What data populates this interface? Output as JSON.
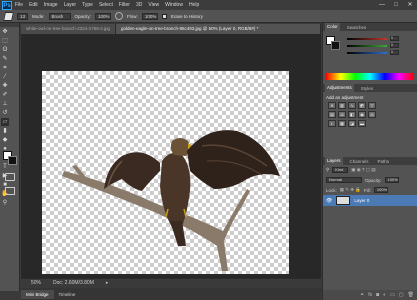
{
  "app": {
    "logo": "Ps"
  },
  "menu": [
    "File",
    "Edit",
    "Image",
    "Layer",
    "Type",
    "Select",
    "Filter",
    "3D",
    "View",
    "Window",
    "Help"
  ],
  "window_controls": {
    "minimize": "—",
    "maximize": "□",
    "close": "✕"
  },
  "options_bar": {
    "mode_label": "Mode:",
    "mode_value": "Brush",
    "opacity_label": "Opacity:",
    "opacity_value": "100%",
    "flow_label": "Flow:",
    "flow_value": "100%",
    "erase_history_label": "Erase to History",
    "brush_size": "13"
  },
  "doc_tabs": [
    {
      "label": "white-owl-on-tree-branch-2324-2758-2.jpg"
    },
    {
      "label": "golden-eagle-on-tree-branch-86c493.jpg @ 50% (Layer 0, RGB/8#) *"
    }
  ],
  "status": {
    "zoom": "50%",
    "doc": "Doc: 2.60M/3.80M"
  },
  "bottom_tabs": [
    "Mini Bridge",
    "Timeline"
  ],
  "color_panel": {
    "tabs": [
      "Color",
      "Swatches"
    ],
    "sliders": [
      {
        "value": "0"
      },
      {
        "value": "0"
      },
      {
        "value": "0"
      }
    ],
    "colors": {
      "r": "#c0392b",
      "g": "#3aaa35",
      "b": "#2d6fd6"
    }
  },
  "adjustments_panel": {
    "tabs": [
      "Adjustments",
      "Styles"
    ],
    "title": "Add an adjustment"
  },
  "layers_panel": {
    "tabs": [
      "Layers",
      "Channels",
      "Paths"
    ],
    "kind_label": "Kind",
    "blend_mode": "Normal",
    "opacity_label": "Opacity:",
    "opacity_value": "100%",
    "lock_label": "Lock:",
    "fill_label": "Fill:",
    "fill_value": "100%",
    "layers": [
      {
        "name": "Layer 0"
      }
    ]
  },
  "colors": {
    "accent": "#4c7ab5",
    "panel": "#535353",
    "chrome": "#3c3c3c"
  }
}
